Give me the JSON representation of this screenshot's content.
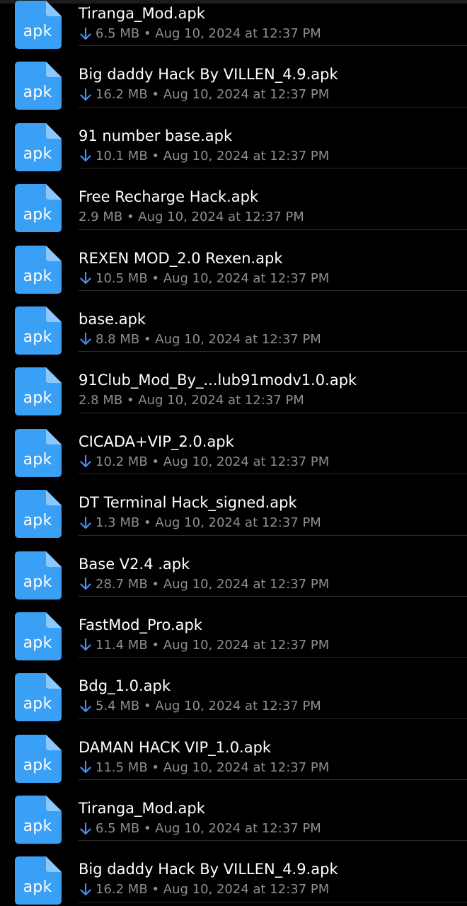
{
  "colors": {
    "background": "#000000",
    "icon_blue": "#3aa0f5",
    "download_arrow": "#4a8ef5",
    "meta_gray": "#8e8e93",
    "separator": "#2c2c2e"
  },
  "icon": {
    "name": "apk-file-icon",
    "label": "apk"
  },
  "files": [
    {
      "name": "Tiranga_Mod.apk",
      "size": "6.5 MB",
      "date": "Aug 10, 2024 at 12:37 PM",
      "downloading": true
    },
    {
      "name": "Big daddy Hack By VILLEN_4.9.apk",
      "size": "16.2 MB",
      "date": "Aug 10, 2024 at 12:37 PM",
      "downloading": true
    },
    {
      "name": "91 number base.apk",
      "size": "10.1 MB",
      "date": "Aug 10, 2024 at 12:37 PM",
      "downloading": true
    },
    {
      "name": "Free Recharge Hack.apk",
      "size": "2.9 MB",
      "date": "Aug 10, 2024 at 12:37 PM",
      "downloading": false
    },
    {
      "name": "REXEN MOD_2.0 Rexen.apk",
      "size": "10.5 MB",
      "date": "Aug 10, 2024 at 12:37 PM",
      "downloading": true
    },
    {
      "name": "base.apk",
      "size": "8.8 MB",
      "date": "Aug 10, 2024 at 12:37 PM",
      "downloading": true
    },
    {
      "name": "91Club_Mod_By_...lub91modv1.0.apk",
      "size": "2.8 MB",
      "date": "Aug 10, 2024 at 12:37 PM",
      "downloading": false
    },
    {
      "name": "CICADA+VIP_2.0.apk",
      "size": "10.2 MB",
      "date": "Aug 10, 2024 at 12:37 PM",
      "downloading": true
    },
    {
      "name": "DT Terminal Hack_signed.apk",
      "size": "1.3 MB",
      "date": "Aug 10, 2024 at 12:37 PM",
      "downloading": true
    },
    {
      "name": "Base V2.4 .apk",
      "size": "28.7 MB",
      "date": "Aug 10, 2024 at 12:37 PM",
      "downloading": true
    },
    {
      "name": "FastMod_Pro.apk",
      "size": "11.4 MB",
      "date": "Aug 10, 2024 at 12:37 PM",
      "downloading": true
    },
    {
      "name": "Bdg_1.0.apk",
      "size": "5.4 MB",
      "date": "Aug 10, 2024 at 12:37 PM",
      "downloading": true
    },
    {
      "name": "DAMAN HACK VIP_1.0.apk",
      "size": "11.5 MB",
      "date": "Aug 10, 2024 at 12:37 PM",
      "downloading": true
    },
    {
      "name": "Tiranga_Mod.apk",
      "size": "6.5 MB",
      "date": "Aug 10, 2024 at 12:37 PM",
      "downloading": true
    },
    {
      "name": "Big daddy Hack By VILLEN_4.9.apk",
      "size": "16.2 MB",
      "date": "Aug 10, 2024 at 12:37 PM",
      "downloading": true
    }
  ]
}
